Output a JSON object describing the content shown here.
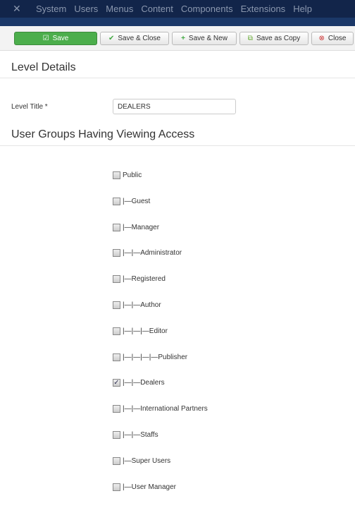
{
  "nav": {
    "items": [
      "System",
      "Users",
      "Menus",
      "Content",
      "Components",
      "Extensions",
      "Help"
    ]
  },
  "toolbar": {
    "save": "Save",
    "save_close": "Save & Close",
    "save_new": "Save & New",
    "save_copy": "Save as Copy",
    "close": "Close"
  },
  "details": {
    "heading": "Level Details",
    "title_label": "Level Title *",
    "title_value": "DEALERS"
  },
  "groups": {
    "heading": "User Groups Having Viewing Access",
    "items": [
      {
        "label": "Public",
        "checked": false
      },
      {
        "label": "|—Guest",
        "checked": false
      },
      {
        "label": "|—Manager",
        "checked": false
      },
      {
        "label": "|—|—Administrator",
        "checked": false
      },
      {
        "label": "|—Registered",
        "checked": false
      },
      {
        "label": "|—|—Author",
        "checked": false
      },
      {
        "label": "|—|—|—Editor",
        "checked": false
      },
      {
        "label": "|—|—|—|—Publisher",
        "checked": false
      },
      {
        "label": "|—|—Dealers",
        "checked": true
      },
      {
        "label": "|—|—International Partners",
        "checked": false
      },
      {
        "label": "|—|—Staffs",
        "checked": false
      },
      {
        "label": "|—Super Users",
        "checked": false
      },
      {
        "label": "|—User Manager",
        "checked": false
      }
    ]
  }
}
